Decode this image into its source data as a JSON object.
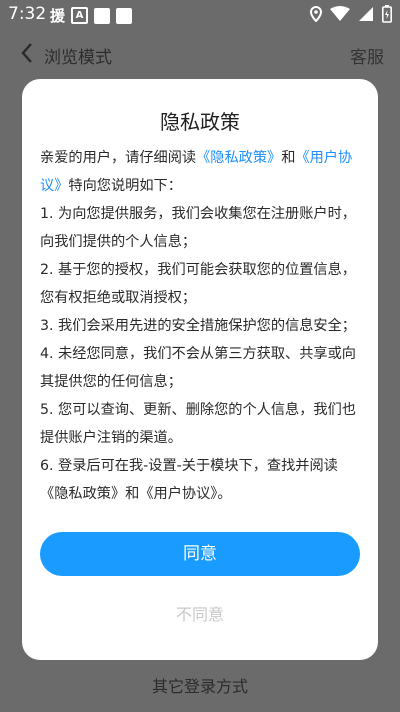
{
  "status_bar": {
    "time": "7:32",
    "left_icons": [
      "援",
      "A"
    ],
    "right_icons": [
      "location-icon",
      "wifi-icon",
      "signal-icon",
      "battery-icon"
    ]
  },
  "appbar": {
    "back_icon": "chevron-left-icon",
    "title": "浏览模式",
    "service": "客服"
  },
  "bottom_link": "其它登录方式",
  "dialog": {
    "title": "隐私政策",
    "intro_prefix": "亲爱的用户，请仔细阅读",
    "privacy_link": "《隐私政策》",
    "and": "和",
    "user_link": "《用户协议》",
    "intro_suffix": "特向您说明如下：",
    "items": [
      "1. 为向您提供服务，我们会收集您在注册账户时，向我们提供的个人信息；",
      "2. 基于您的授权，我们可能会获取您的位置信息，您有权拒绝或取消授权；",
      "3. 我们会采用先进的安全措施保护您的信息安全；",
      "4. 未经您同意，我们不会从第三方获取、共享或向其提供您的任何信息；",
      "5. 您可以查询、更新、删除您的个人信息，我们也提供账户注销的渠道。",
      "6. 登录后可在我-设置-关于模块下，查找并阅读《隐私政策》和《用户协议》。"
    ],
    "agree": "同意",
    "disagree": "不同意"
  },
  "colors": {
    "accent": "#1a9bff",
    "link": "#1e90ff",
    "overlay": "#6b6b6b"
  }
}
